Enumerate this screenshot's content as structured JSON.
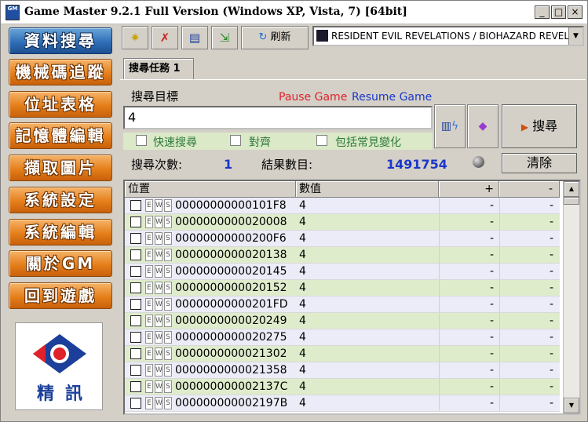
{
  "window": {
    "title": "Game Master 9.2.1 Full Version (Windows XP, Vista, 7) [64bit]",
    "app_icon_label": "GM",
    "minimize": "_",
    "maximize": "□",
    "close": "×"
  },
  "sidebar": {
    "items": [
      {
        "label": "資料搜尋",
        "active": true
      },
      {
        "label": "機械碼追蹤"
      },
      {
        "label": "位址表格"
      },
      {
        "label": "記憶體編輯"
      },
      {
        "label": "擷取圖片"
      },
      {
        "label": "系統設定"
      },
      {
        "label": "系統編輯"
      },
      {
        "label": "關於GM"
      },
      {
        "label": "回到遊戲"
      }
    ],
    "logo_text": "精訊"
  },
  "toolbar": {
    "refresh_label": "刷新",
    "game_selected": "RESIDENT EVIL REVELATIONS / BIOHAZARD REVELA"
  },
  "tab": {
    "label": "搜尋任務 1"
  },
  "search": {
    "target_label": "搜尋目標",
    "pause_label": "Pause Game",
    "resume_label": "Resume Game",
    "value": "4",
    "fast_search_label": "快速搜尋",
    "align_label": "對齊",
    "include_label": "包括常見變化",
    "search_button": "搜尋",
    "count_label": "搜尋次數:",
    "count_value": "1",
    "results_label": "結果數目:",
    "results_value": "1491754",
    "clear_button": "清除"
  },
  "table": {
    "columns": [
      "位置",
      "數值",
      "+",
      "-"
    ],
    "rows": [
      {
        "addr": "00000000000101F8",
        "val": "4",
        "c3": "-",
        "c4": "-"
      },
      {
        "addr": "0000000000020008",
        "val": "4",
        "c3": "-",
        "c4": "-"
      },
      {
        "addr": "00000000000200F6",
        "val": "4",
        "c3": "-",
        "c4": "-"
      },
      {
        "addr": "0000000000020138",
        "val": "4",
        "c3": "-",
        "c4": "-"
      },
      {
        "addr": "0000000000020145",
        "val": "4",
        "c3": "-",
        "c4": "-"
      },
      {
        "addr": "0000000000020152",
        "val": "4",
        "c3": "-",
        "c4": "-"
      },
      {
        "addr": "00000000000201FD",
        "val": "4",
        "c3": "-",
        "c4": "-"
      },
      {
        "addr": "0000000000020249",
        "val": "4",
        "c3": "-",
        "c4": "-"
      },
      {
        "addr": "0000000000020275",
        "val": "4",
        "c3": "-",
        "c4": "-"
      },
      {
        "addr": "0000000000021302",
        "val": "4",
        "c3": "-",
        "c4": "-"
      },
      {
        "addr": "0000000000021358",
        "val": "4",
        "c3": "-",
        "c4": "-"
      },
      {
        "addr": "000000000002137C",
        "val": "4",
        "c3": "-",
        "c4": "-"
      },
      {
        "addr": "000000000002197B",
        "val": "4",
        "c3": "-",
        "c4": "-"
      }
    ]
  },
  "colors": {
    "pause": "#e0222a",
    "resume": "#1b37c8",
    "option_text": "#2d7a3b",
    "stat_value": "#1b37c8"
  }
}
